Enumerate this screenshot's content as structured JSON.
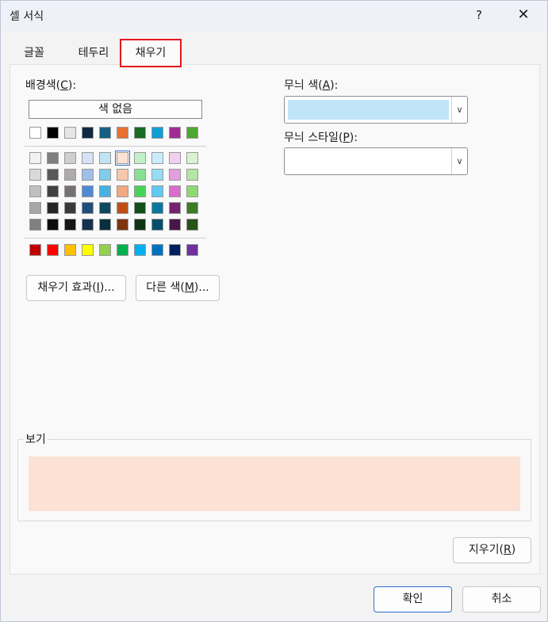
{
  "dialog": {
    "title": "셀 서식",
    "help_label": "?",
    "close_label": "✕"
  },
  "tabs": [
    {
      "label": "글꼴"
    },
    {
      "label": "테두리"
    },
    {
      "label": "채우기",
      "selected": true
    }
  ],
  "background_color": {
    "label": "배경색",
    "accesskey": "C",
    "no_color_label": "색 없음",
    "palette_theme": [
      [
        "#ffffff",
        "#000000",
        "#e7e6e6",
        "#0e2841",
        "#156082",
        "#e97132",
        "#196b24",
        "#0f9ed5",
        "#a02b93",
        "#4ea72e"
      ]
    ],
    "palette_tints": [
      [
        "#f2f2f2",
        "#7f7f7f",
        "#d0cece",
        "#d6e3f5",
        "#c0e4f5",
        "#fbe2d5",
        "#c1f0c8",
        "#caedfb",
        "#f2cfee",
        "#daf2d0"
      ],
      [
        "#d9d9d9",
        "#595959",
        "#aeaaaa",
        "#9fbfe8",
        "#83cbeb",
        "#f7c7ac",
        "#84e291",
        "#95dcf7",
        "#e49edd",
        "#b4e5a2"
      ],
      [
        "#bfbfbf",
        "#404040",
        "#767171",
        "#4d8ad4",
        "#47b1e2",
        "#f1a983",
        "#47d45a",
        "#60caf3",
        "#d86dcb",
        "#8ed973"
      ],
      [
        "#a6a6a6",
        "#262626",
        "#3b3838",
        "#1f4e79",
        "#0f4761",
        "#c04f15",
        "#124f1a",
        "#0b76a0",
        "#782170",
        "#3b7d23"
      ],
      [
        "#808080",
        "#0d0d0d",
        "#171515",
        "#153350",
        "#0a2f40",
        "#7e350e",
        "#0c3511",
        "#074f6a",
        "#4b154a",
        "#275317"
      ]
    ],
    "palette_standard": [
      [
        "#c00000",
        "#ff0000",
        "#ffc000",
        "#ffff00",
        "#92d050",
        "#00b050",
        "#00b0f0",
        "#0070c0",
        "#002060",
        "#7030a0"
      ]
    ],
    "selected_color": "#fbe2d5"
  },
  "buttons": {
    "fill_effects": "채우기 효과",
    "fill_effects_key": "I",
    "more_colors": "다른 색",
    "more_colors_key": "M",
    "ellipsis": "...",
    "clear": "지우기",
    "clear_key": "R",
    "ok": "확인",
    "cancel": "취소"
  },
  "pattern_color": {
    "label": "무늬 색",
    "accesskey": "A",
    "value_color": "#bfe4f7"
  },
  "pattern_style": {
    "label": "무늬 스타일",
    "accesskey": "P"
  },
  "preview": {
    "label": "보기",
    "fill_color": "#fbe2d5"
  },
  "icons": {
    "dropdown": "chevron-down-icon",
    "close": "close-icon",
    "help": "help-icon"
  }
}
